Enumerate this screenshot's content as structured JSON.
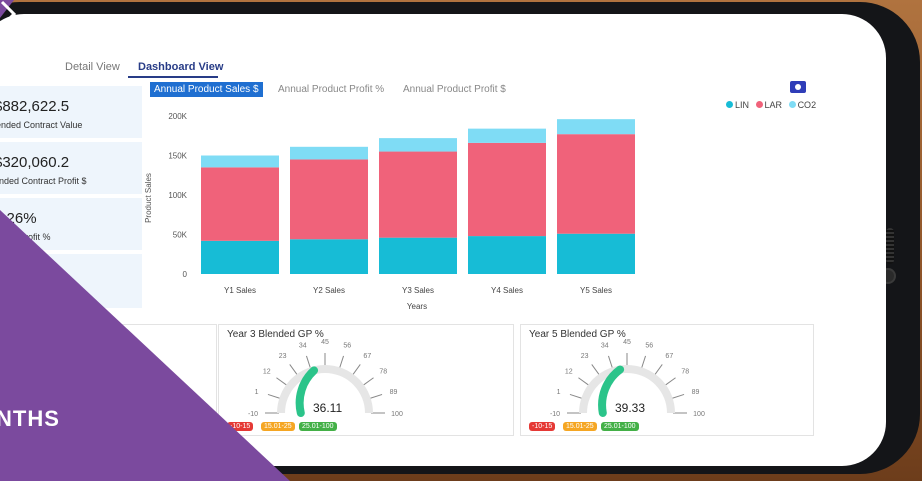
{
  "tabs": [
    {
      "label": "Detail View"
    },
    {
      "label": "Dashboard View"
    }
  ],
  "kpis": [
    {
      "value": "$882,622.5",
      "label": "lended Contract Value"
    },
    {
      "value": "$320,060.2",
      "label": "ended Contract Profit $"
    },
    {
      "value": "6.26%",
      "label": "ntract Profit %"
    }
  ],
  "chart_tabs": [
    {
      "label": "Annual Product Sales $"
    },
    {
      "label": "Annual Product Profit %"
    },
    {
      "label": "Annual Product Profit $"
    }
  ],
  "legend": [
    {
      "name": "LIN",
      "color": "#17bcd6"
    },
    {
      "name": "LAR",
      "color": "#f0627a"
    },
    {
      "name": "CO2",
      "color": "#7fdcf5"
    }
  ],
  "chart_data": {
    "type": "bar",
    "stacked": true,
    "categories": [
      "Y1 Sales",
      "Y2 Sales",
      "Y3 Sales",
      "Y4 Sales",
      "Y5 Sales"
    ],
    "series": [
      {
        "name": "LIN",
        "color": "#17bcd6",
        "values": [
          42000,
          44000,
          46000,
          48000,
          51000
        ]
      },
      {
        "name": "LAR",
        "color": "#f0627a",
        "values": [
          93000,
          101000,
          109000,
          118000,
          126000
        ]
      },
      {
        "name": "CO2",
        "color": "#7fdcf5",
        "values": [
          15000,
          16000,
          17000,
          18000,
          19000
        ]
      }
    ],
    "ylim": [
      0,
      200000
    ],
    "yticks": [
      "200K",
      "150K",
      "100K",
      "50K",
      "0"
    ],
    "xlabel": "Years",
    "ylabel": "Product Sales"
  },
  "gauges": [
    {
      "title": "Year 3 Blended GP %",
      "value": "36.11",
      "ticks": [
        "-10",
        "1",
        "12",
        "23",
        "34",
        "45",
        "56",
        "67",
        "78",
        "89",
        "100"
      ],
      "fraction": 0.42
    },
    {
      "title": "Year 5 Blended GP %",
      "value": "39.33",
      "ticks": [
        "-10",
        "1",
        "12",
        "23",
        "34",
        "45",
        "56",
        "67",
        "78",
        "89",
        "100"
      ],
      "fraction": 0.45
    }
  ],
  "badges": [
    {
      "label": "-10-15",
      "color": "#e53935"
    },
    {
      "label": "15.01-25",
      "color": "#f5a623"
    },
    {
      "label": "25.01-100",
      "color": "#43b047"
    }
  ],
  "banner": {
    "text": "NTHS"
  }
}
